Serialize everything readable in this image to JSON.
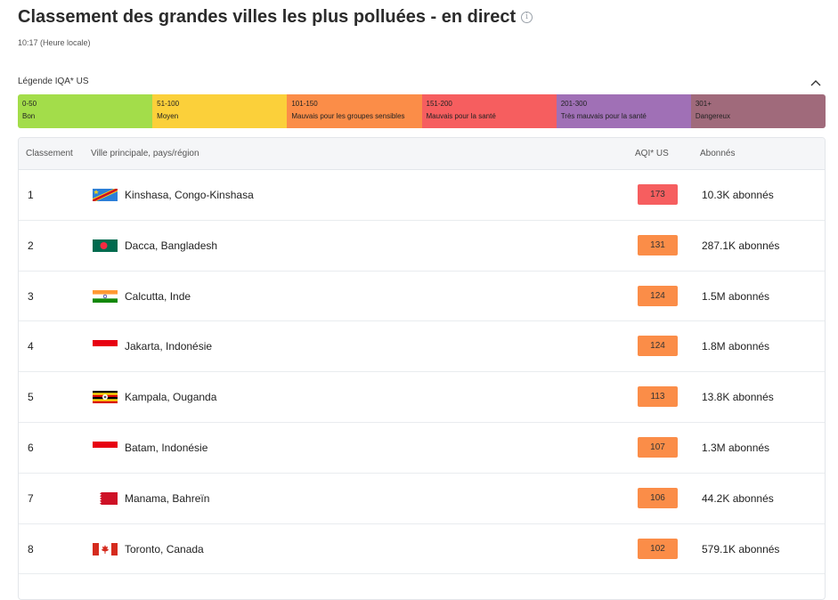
{
  "header": {
    "title": "Classement des grandes villes les plus polluées - en direct",
    "subtitle": "10:17 (Heure locale)",
    "info_icon": "info-icon"
  },
  "legend": {
    "title": "Légende IQA* US",
    "toggle_icon": "chevron-up-icon",
    "segments": [
      {
        "range": "0-50",
        "label": "Bon",
        "color": "#a3dd4a"
      },
      {
        "range": "51-100",
        "label": "Moyen",
        "color": "#fbd03a"
      },
      {
        "range": "101-150",
        "label": "Mauvais pour les groupes sensibles",
        "color": "#fb8d48"
      },
      {
        "range": "151-200",
        "label": "Mauvais pour la santé",
        "color": "#f65e5f"
      },
      {
        "range": "201-300",
        "label": "Très mauvais pour la santé",
        "color": "#a070b6"
      },
      {
        "range": "301+",
        "label": "Dangereux",
        "color": "#a06a7b"
      }
    ]
  },
  "table": {
    "headers": {
      "rank": "Classement",
      "city": "Ville principale, pays/région",
      "aqi": "AQI* US",
      "subscribers": "Abonnés"
    },
    "rows": [
      {
        "rank": "1",
        "city": "Kinshasa, Congo-Kinshasa",
        "aqi": "173",
        "aqi_color": "#f65e5f",
        "subscribers": "10.3K abonnés",
        "flag": "flag-drc"
      },
      {
        "rank": "2",
        "city": "Dacca, Bangladesh",
        "aqi": "131",
        "aqi_color": "#fb8d48",
        "subscribers": "287.1K abonnés",
        "flag": "flag-bangladesh"
      },
      {
        "rank": "3",
        "city": "Calcutta, Inde",
        "aqi": "124",
        "aqi_color": "#fb8d48",
        "subscribers": "1.5M abonnés",
        "flag": "flag-india"
      },
      {
        "rank": "4",
        "city": "Jakarta, Indonésie",
        "aqi": "124",
        "aqi_color": "#fb8d48",
        "subscribers": "1.8M abonnés",
        "flag": "flag-indonesia"
      },
      {
        "rank": "5",
        "city": "Kampala, Ouganda",
        "aqi": "113",
        "aqi_color": "#fb8d48",
        "subscribers": "13.8K abonnés",
        "flag": "flag-uganda"
      },
      {
        "rank": "6",
        "city": "Batam, Indonésie",
        "aqi": "107",
        "aqi_color": "#fb8d48",
        "subscribers": "1.3M abonnés",
        "flag": "flag-indonesia"
      },
      {
        "rank": "7",
        "city": "Manama, Bahreïn",
        "aqi": "106",
        "aqi_color": "#fb8d48",
        "subscribers": "44.2K abonnés",
        "flag": "flag-bahrain"
      },
      {
        "rank": "8",
        "city": "Toronto, Canada",
        "aqi": "102",
        "aqi_color": "#fb8d48",
        "subscribers": "579.1K abonnés",
        "flag": "flag-canada"
      }
    ]
  }
}
